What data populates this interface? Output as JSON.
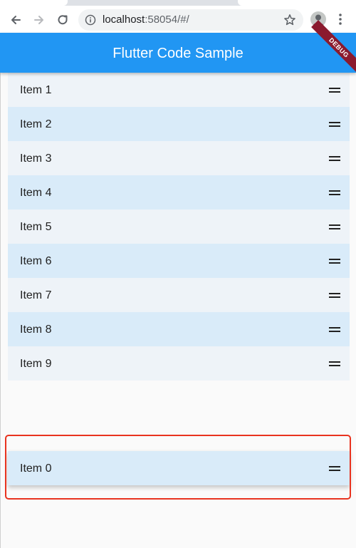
{
  "browser": {
    "url_host": "localhost",
    "url_rest": ":58054/#/",
    "icons": {
      "back": "arrow-left-icon",
      "forward": "arrow-right-icon",
      "reload": "reload-icon",
      "info": "info-icon",
      "bookmark": "star-icon",
      "profile": "person-icon",
      "menu": "vertical-dots-icon"
    }
  },
  "appbar": {
    "title": "Flutter Code Sample",
    "debug_banner": "DEBUG",
    "color": "#2196f3"
  },
  "list": {
    "items": [
      {
        "label": "Item 1"
      },
      {
        "label": "Item 2"
      },
      {
        "label": "Item 3"
      },
      {
        "label": "Item 4"
      },
      {
        "label": "Item 5"
      },
      {
        "label": "Item 6"
      },
      {
        "label": "Item 7"
      },
      {
        "label": "Item 8"
      },
      {
        "label": "Item 9"
      }
    ],
    "odd_color": "#eef3f8",
    "even_color": "#d9ebf9",
    "handle_icon": "drag-handle-icon"
  },
  "dragged_item": {
    "label": "Item 0"
  },
  "annotation": {
    "color": "#e8331f"
  }
}
